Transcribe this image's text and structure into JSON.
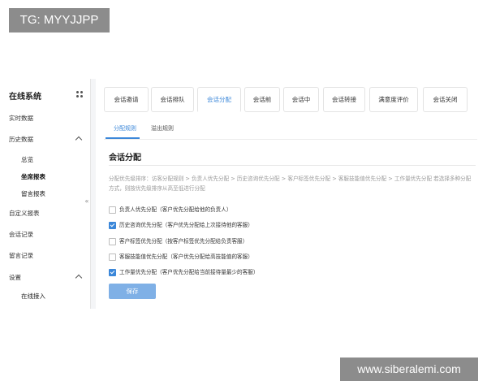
{
  "watermark": {
    "top": "TG: MYYJJPP",
    "bottom": "www.siberalemi.com"
  },
  "sidebar": {
    "title": "在线系统",
    "items": [
      {
        "label": "实时数据"
      },
      {
        "label": "历史数据"
      },
      {
        "label": "总览"
      },
      {
        "label": "坐席报表"
      },
      {
        "label": "留言报表"
      },
      {
        "label": "自定义报表"
      },
      {
        "label": "会话记录"
      },
      {
        "label": "留言记录"
      },
      {
        "label": "设置"
      },
      {
        "label": "在线接入"
      }
    ],
    "collapse_glyph": "«"
  },
  "tabs": [
    {
      "label": "会话邀请"
    },
    {
      "label": "会话排队"
    },
    {
      "label": "会话分配"
    },
    {
      "label": "会话前"
    },
    {
      "label": "会话中"
    },
    {
      "label": "会话转接"
    },
    {
      "label": "满意度评价"
    },
    {
      "label": "会话关闭"
    }
  ],
  "subtabs": [
    {
      "label": "分配规则"
    },
    {
      "label": "溢出规则"
    }
  ],
  "section": {
    "title": "会话分配",
    "description": "分配优先级排序：访客分配规则 > 负责人优先分配 > 历史咨询优先分配 > 客户标签优先分配 > 客服技能值优先分配 > 工作量优先分配 若选择多种分配方式，则按优先级排序从高至低进行分配"
  },
  "options": [
    {
      "label": "负责人优先分配（客户优先分配给他的负责人）",
      "checked": false
    },
    {
      "label": "历史咨询优先分配（客户优先分配给上次接待他的客服）",
      "checked": true
    },
    {
      "label": "客户标签优先分配（按客户标签优先分配给负责客服）",
      "checked": false
    },
    {
      "label": "客服技能值优先分配（客户优先分配给高技能值的客服）",
      "checked": false
    },
    {
      "label": "工作量优先分配（客户优先分配给当前接待量最少的客服）",
      "checked": true
    }
  ],
  "actions": {
    "save_label": "保存"
  },
  "colors": {
    "accent": "#3b87d9",
    "button": "#7fb0e6"
  }
}
